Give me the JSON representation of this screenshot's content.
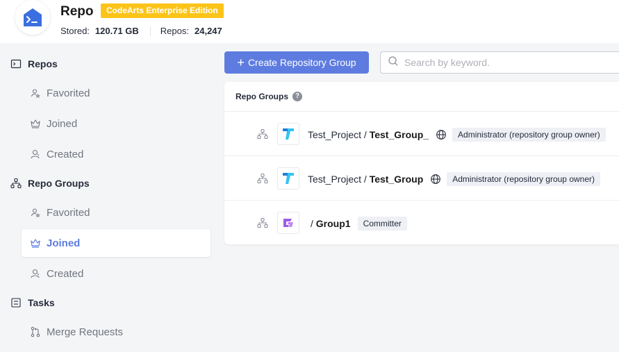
{
  "header": {
    "title": "Repo",
    "edition": "CodeArts Enterprise Edition",
    "stored_label": "Stored:",
    "stored_value": "120.71 GB",
    "repos_label": "Repos:",
    "repos_value": "24,247"
  },
  "sidebar": {
    "repos": {
      "label": "Repos",
      "items": [
        {
          "label": "Favorited",
          "icon": "star-person-icon"
        },
        {
          "label": "Joined",
          "icon": "crown-icon"
        },
        {
          "label": "Created",
          "icon": "user-icon"
        }
      ]
    },
    "repo_groups": {
      "label": "Repo Groups",
      "items": [
        {
          "label": "Favorited",
          "icon": "star-person-icon"
        },
        {
          "label": "Joined",
          "icon": "crown-icon",
          "active": true
        },
        {
          "label": "Created",
          "icon": "user-icon"
        }
      ]
    },
    "tasks": {
      "label": "Tasks",
      "items": [
        {
          "label": "Merge Requests",
          "icon": "merge-request-icon"
        }
      ]
    }
  },
  "toolbar": {
    "create_label": "Create Repository Group",
    "search_placeholder": "Search by keyword."
  },
  "card": {
    "title": "Repo Groups",
    "rows": [
      {
        "project": "Test_Project / ",
        "group": "Test_Group_",
        "public": true,
        "role": "Administrator (repository group owner)"
      },
      {
        "project": "Test_Project / ",
        "group": "Test_Group",
        "public": true,
        "role": "Administrator (repository group owner)"
      },
      {
        "project": "/ ",
        "group": "Group1",
        "public": false,
        "role": "Committer"
      }
    ]
  },
  "colors": {
    "accent": "#5e7ce0",
    "badge": "#fcc419",
    "logo": "#3b6fe0"
  }
}
